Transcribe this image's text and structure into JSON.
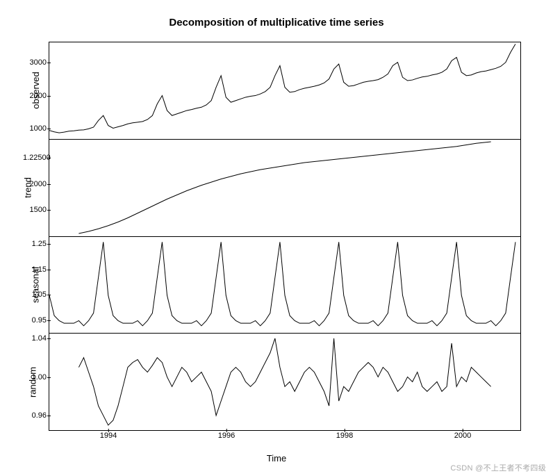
{
  "title": "Decomposition of multiplicative time series",
  "xlabel": "Time",
  "watermark": "CSDN @不上王者不考四级",
  "xaxis": {
    "min": 1993,
    "max": 2001,
    "ticks": [
      1994,
      1996,
      1998,
      2000
    ]
  },
  "panels": [
    {
      "name": "observed",
      "yticks": [
        1000,
        2000,
        3000
      ],
      "ymin": 700,
      "ymax": 3600
    },
    {
      "name": "trend",
      "yticks": [
        1500,
        2000,
        2500
      ],
      "ymin": 1000,
      "ymax": 2850,
      "tick_prefix": "1.2",
      "tick_prefix_for": 0
    },
    {
      "name": "seasonal",
      "yticks": [
        0.95,
        1.05,
        1.15,
        1.25
      ],
      "ymin": 0.9,
      "ymax": 1.28,
      "fmt": "fixed2",
      "last_tick_prefix": "1.04"
    },
    {
      "name": "random",
      "yticks": [
        0.96,
        1.0,
        1.04
      ],
      "ymin": 0.945,
      "ymax": 1.045,
      "fmt": "fixed2"
    }
  ],
  "chart_data": [
    {
      "type": "line",
      "name": "observed",
      "title": "Decomposition of multiplicative time series",
      "xlabel": "Time",
      "ylabel": "observed",
      "xlim": [
        1993,
        2001
      ],
      "ylim": [
        700,
        3600
      ],
      "x_step": 0.083333,
      "x": [
        1993.0,
        1993.083,
        1993.167,
        1993.25,
        1993.333,
        1993.417,
        1993.5,
        1993.583,
        1993.667,
        1993.75,
        1993.833,
        1993.917,
        1994.0,
        1994.083,
        1994.167,
        1994.25,
        1994.333,
        1994.417,
        1994.5,
        1994.583,
        1994.667,
        1994.75,
        1994.833,
        1994.917,
        1995.0,
        1995.083,
        1995.167,
        1995.25,
        1995.333,
        1995.417,
        1995.5,
        1995.583,
        1995.667,
        1995.75,
        1995.833,
        1995.917,
        1996.0,
        1996.083,
        1996.167,
        1996.25,
        1996.333,
        1996.417,
        1996.5,
        1996.583,
        1996.667,
        1996.75,
        1996.833,
        1996.917,
        1997.0,
        1997.083,
        1997.167,
        1997.25,
        1997.333,
        1997.417,
        1997.5,
        1997.583,
        1997.667,
        1997.75,
        1997.833,
        1997.917,
        1998.0,
        1998.083,
        1998.167,
        1998.25,
        1998.333,
        1998.417,
        1998.5,
        1998.583,
        1998.667,
        1998.75,
        1998.833,
        1998.917,
        1999.0,
        1999.083,
        1999.167,
        1999.25,
        1999.333,
        1999.417,
        1999.5,
        1999.583,
        1999.667,
        1999.75,
        1999.833,
        1999.917,
        2000.0,
        2000.083,
        2000.167,
        2000.25,
        2000.333,
        2000.417,
        2000.5,
        2000.583,
        2000.667,
        2000.75,
        2000.833,
        2000.917
      ],
      "values": [
        950,
        910,
        880,
        900,
        930,
        940,
        960,
        970,
        1000,
        1050,
        1250,
        1400,
        1100,
        1020,
        1060,
        1100,
        1150,
        1180,
        1200,
        1220,
        1280,
        1400,
        1750,
        2000,
        1550,
        1400,
        1450,
        1500,
        1550,
        1580,
        1620,
        1650,
        1720,
        1850,
        2250,
        2600,
        1950,
        1800,
        1850,
        1900,
        1950,
        1980,
        2000,
        2050,
        2120,
        2250,
        2600,
        2900,
        2250,
        2100,
        2120,
        2180,
        2220,
        2250,
        2280,
        2320,
        2380,
        2500,
        2800,
        2950,
        2400,
        2280,
        2300,
        2350,
        2400,
        2430,
        2450,
        2480,
        2550,
        2650,
        2900,
        3000,
        2550,
        2450,
        2470,
        2520,
        2560,
        2580,
        2620,
        2650,
        2700,
        2800,
        3050,
        3150,
        2700,
        2600,
        2620,
        2680,
        2720,
        2740,
        2780,
        2820,
        2880,
        3000,
        3300,
        3550
      ]
    },
    {
      "type": "line",
      "name": "trend",
      "xlabel": "Time",
      "ylabel": "trend",
      "xlim": [
        1993,
        2001
      ],
      "ylim": [
        1000,
        2850
      ],
      "x_step": 0.083333,
      "x": [
        1993.5,
        1993.583,
        1993.667,
        1993.75,
        1993.833,
        1993.917,
        1994.0,
        1994.083,
        1994.167,
        1994.25,
        1994.333,
        1994.417,
        1994.5,
        1994.583,
        1994.667,
        1994.75,
        1994.833,
        1994.917,
        1995.0,
        1995.083,
        1995.167,
        1995.25,
        1995.333,
        1995.417,
        1995.5,
        1995.583,
        1995.667,
        1995.75,
        1995.833,
        1995.917,
        1996.0,
        1996.083,
        1996.167,
        1996.25,
        1996.333,
        1996.417,
        1996.5,
        1996.583,
        1996.667,
        1996.75,
        1996.833,
        1996.917,
        1997.0,
        1997.083,
        1997.167,
        1997.25,
        1997.333,
        1997.417,
        1997.5,
        1997.583,
        1997.667,
        1997.75,
        1997.833,
        1997.917,
        1998.0,
        1998.083,
        1998.167,
        1998.25,
        1998.333,
        1998.417,
        1998.5,
        1998.583,
        1998.667,
        1998.75,
        1998.833,
        1998.917,
        1999.0,
        1999.083,
        1999.167,
        1999.25,
        1999.333,
        1999.417,
        1999.5,
        1999.583,
        1999.667,
        1999.75,
        1999.833,
        1999.917,
        2000.0,
        2000.083,
        2000.167,
        2000.25,
        2000.333,
        2000.417,
        2000.5
      ],
      "values": [
        1050,
        1070,
        1090,
        1115,
        1140,
        1170,
        1200,
        1235,
        1270,
        1310,
        1350,
        1395,
        1440,
        1485,
        1530,
        1575,
        1620,
        1665,
        1710,
        1750,
        1790,
        1830,
        1870,
        1905,
        1940,
        1975,
        2005,
        2035,
        2065,
        2095,
        2120,
        2145,
        2170,
        2195,
        2215,
        2235,
        2255,
        2275,
        2290,
        2305,
        2320,
        2335,
        2350,
        2365,
        2380,
        2395,
        2410,
        2420,
        2430,
        2440,
        2450,
        2460,
        2470,
        2480,
        2490,
        2500,
        2510,
        2520,
        2530,
        2540,
        2550,
        2560,
        2570,
        2580,
        2590,
        2600,
        2610,
        2620,
        2630,
        2640,
        2650,
        2660,
        2670,
        2680,
        2690,
        2700,
        2710,
        2720,
        2735,
        2750,
        2765,
        2780,
        2790,
        2800,
        2810
      ]
    },
    {
      "type": "line",
      "name": "seasonal",
      "xlabel": "Time",
      "ylabel": "seasonal",
      "xlim": [
        1993,
        2001
      ],
      "ylim": [
        0.9,
        1.28
      ],
      "x_step": 0.083333,
      "x": [
        1993.0,
        1993.083,
        1993.167,
        1993.25,
        1993.333,
        1993.417,
        1993.5,
        1993.583,
        1993.667,
        1993.75,
        1993.833,
        1993.917,
        1994.0,
        1994.083,
        1994.167,
        1994.25,
        1994.333,
        1994.417,
        1994.5,
        1994.583,
        1994.667,
        1994.75,
        1994.833,
        1994.917,
        1995.0,
        1995.083,
        1995.167,
        1995.25,
        1995.333,
        1995.417,
        1995.5,
        1995.583,
        1995.667,
        1995.75,
        1995.833,
        1995.917,
        1996.0,
        1996.083,
        1996.167,
        1996.25,
        1996.333,
        1996.417,
        1996.5,
        1996.583,
        1996.667,
        1996.75,
        1996.833,
        1996.917,
        1997.0,
        1997.083,
        1997.167,
        1997.25,
        1997.333,
        1997.417,
        1997.5,
        1997.583,
        1997.667,
        1997.75,
        1997.833,
        1997.917,
        1998.0,
        1998.083,
        1998.167,
        1998.25,
        1998.333,
        1998.417,
        1998.5,
        1998.583,
        1998.667,
        1998.75,
        1998.833,
        1998.917,
        1999.0,
        1999.083,
        1999.167,
        1999.25,
        1999.333,
        1999.417,
        1999.5,
        1999.583,
        1999.667,
        1999.75,
        1999.833,
        1999.917,
        2000.0,
        2000.083,
        2000.167,
        2000.25,
        2000.333,
        2000.417,
        2000.5,
        2000.583,
        2000.667,
        2000.75,
        2000.833,
        2000.917
      ],
      "values": [
        1.05,
        0.97,
        0.95,
        0.94,
        0.94,
        0.94,
        0.95,
        0.93,
        0.95,
        0.98,
        1.12,
        1.26,
        1.05,
        0.97,
        0.95,
        0.94,
        0.94,
        0.94,
        0.95,
        0.93,
        0.95,
        0.98,
        1.12,
        1.26,
        1.05,
        0.97,
        0.95,
        0.94,
        0.94,
        0.94,
        0.95,
        0.93,
        0.95,
        0.98,
        1.12,
        1.26,
        1.05,
        0.97,
        0.95,
        0.94,
        0.94,
        0.94,
        0.95,
        0.93,
        0.95,
        0.98,
        1.12,
        1.26,
        1.05,
        0.97,
        0.95,
        0.94,
        0.94,
        0.94,
        0.95,
        0.93,
        0.95,
        0.98,
        1.12,
        1.26,
        1.05,
        0.97,
        0.95,
        0.94,
        0.94,
        0.94,
        0.95,
        0.93,
        0.95,
        0.98,
        1.12,
        1.26,
        1.05,
        0.97,
        0.95,
        0.94,
        0.94,
        0.94,
        0.95,
        0.93,
        0.95,
        0.98,
        1.12,
        1.26,
        1.05,
        0.97,
        0.95,
        0.94,
        0.94,
        0.94,
        0.95,
        0.93,
        0.95,
        0.98,
        1.12,
        1.26
      ]
    },
    {
      "type": "line",
      "name": "random",
      "xlabel": "Time",
      "ylabel": "random",
      "xlim": [
        1993,
        2001
      ],
      "ylim": [
        0.945,
        1.045
      ],
      "x_step": 0.083333,
      "x": [
        1993.5,
        1993.583,
        1993.667,
        1993.75,
        1993.833,
        1993.917,
        1994.0,
        1994.083,
        1994.167,
        1994.25,
        1994.333,
        1994.417,
        1994.5,
        1994.583,
        1994.667,
        1994.75,
        1994.833,
        1994.917,
        1995.0,
        1995.083,
        1995.167,
        1995.25,
        1995.333,
        1995.417,
        1995.5,
        1995.583,
        1995.667,
        1995.75,
        1995.833,
        1995.917,
        1996.0,
        1996.083,
        1996.167,
        1996.25,
        1996.333,
        1996.417,
        1996.5,
        1996.583,
        1996.667,
        1996.75,
        1996.833,
        1996.917,
        1997.0,
        1997.083,
        1997.167,
        1997.25,
        1997.333,
        1997.417,
        1997.5,
        1997.583,
        1997.667,
        1997.75,
        1997.833,
        1997.917,
        1998.0,
        1998.083,
        1998.167,
        1998.25,
        1998.333,
        1998.417,
        1998.5,
        1998.583,
        1998.667,
        1998.75,
        1998.833,
        1998.917,
        1999.0,
        1999.083,
        1999.167,
        1999.25,
        1999.333,
        1999.417,
        1999.5,
        1999.583,
        1999.667,
        1999.75,
        1999.833,
        1999.917,
        2000.0,
        2000.083,
        2000.167,
        2000.25,
        2000.333,
        2000.417,
        2000.5
      ],
      "values": [
        1.01,
        1.02,
        1.005,
        0.99,
        0.97,
        0.96,
        0.95,
        0.955,
        0.97,
        0.99,
        1.01,
        1.015,
        1.018,
        1.01,
        1.005,
        1.012,
        1.02,
        1.015,
        1.0,
        0.99,
        1.0,
        1.01,
        1.005,
        0.995,
        1.0,
        1.005,
        0.995,
        0.985,
        0.96,
        0.975,
        0.99,
        1.005,
        1.01,
        1.005,
        0.995,
        0.99,
        0.995,
        1.005,
        1.015,
        1.025,
        1.04,
        1.01,
        0.99,
        0.995,
        0.985,
        0.995,
        1.005,
        1.01,
        1.005,
        0.995,
        0.985,
        0.97,
        1.04,
        0.975,
        0.99,
        0.985,
        0.995,
        1.005,
        1.01,
        1.015,
        1.01,
        1.0,
        1.01,
        1.005,
        0.995,
        0.985,
        0.99,
        1.0,
        0.995,
        1.005,
        0.99,
        0.985,
        0.99,
        0.995,
        0.985,
        0.99,
        1.035,
        0.99,
        1.0,
        0.995,
        1.01,
        1.005,
        1.0,
        0.995,
        0.99
      ]
    }
  ]
}
